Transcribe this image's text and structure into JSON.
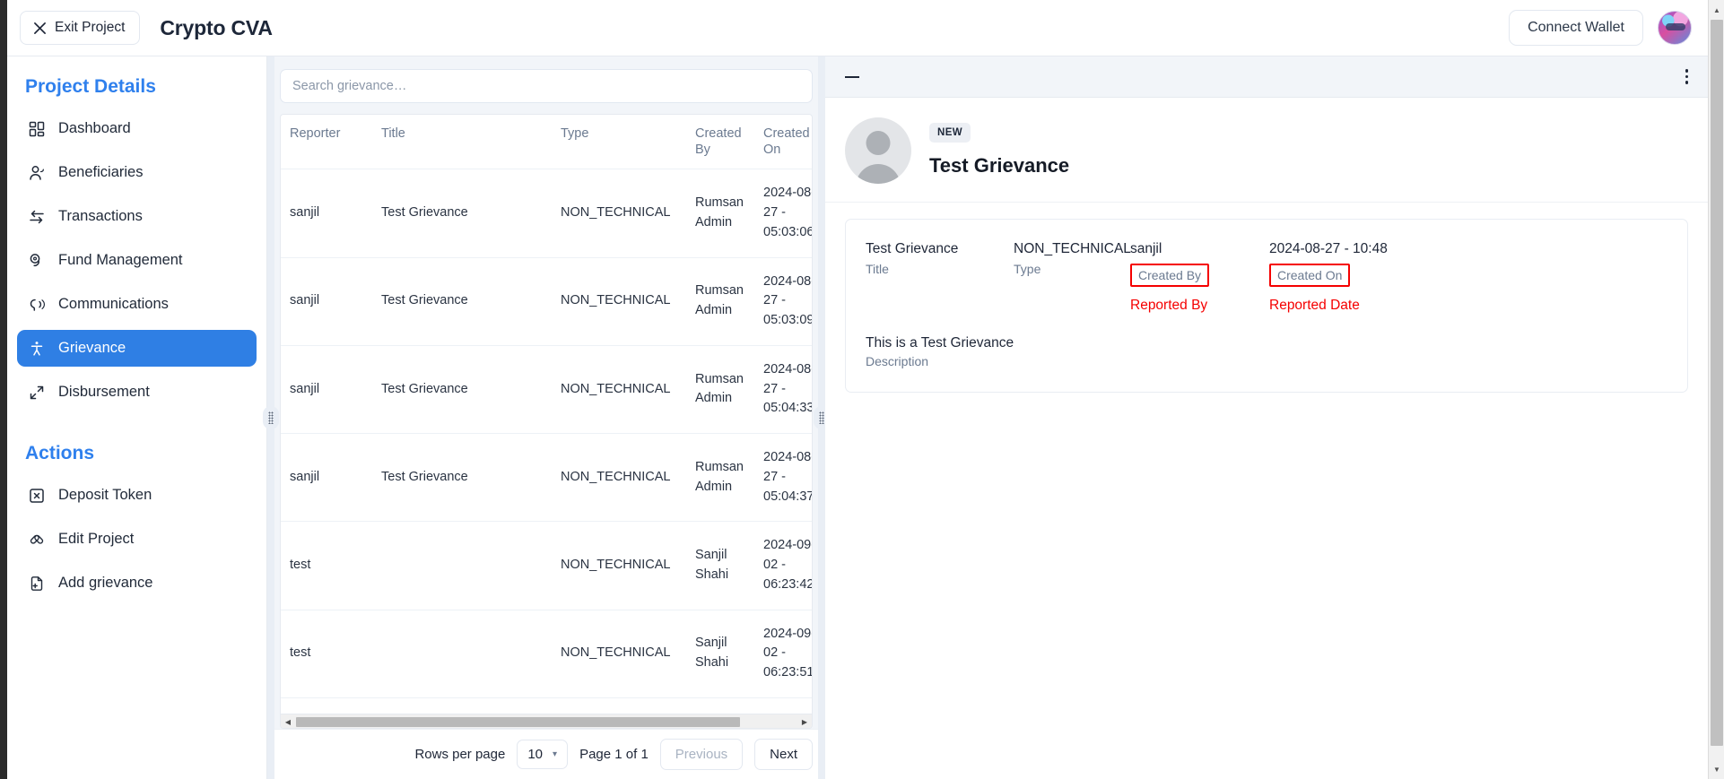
{
  "topbar": {
    "exit_label": "Exit Project",
    "app_title": "Crypto CVA",
    "connect_label": "Connect Wallet",
    "avatar_name": "user-avatar"
  },
  "sidebar": {
    "project_heading": "Project Details",
    "actions_heading": "Actions",
    "nav": [
      {
        "label": "Dashboard",
        "icon": "grid-icon",
        "active": false
      },
      {
        "label": "Beneficiaries",
        "icon": "users-icon",
        "active": false
      },
      {
        "label": "Transactions",
        "icon": "transfer-icon",
        "active": false
      },
      {
        "label": "Fund Management",
        "icon": "coins-icon",
        "active": false
      },
      {
        "label": "Communications",
        "icon": "megaphone-icon",
        "active": false
      },
      {
        "label": "Grievance",
        "icon": "accessibility-icon",
        "active": true
      },
      {
        "label": "Disbursement",
        "icon": "expand-icon",
        "active": false
      }
    ],
    "actions": [
      {
        "label": "Deposit Token",
        "icon": "token-box-icon"
      },
      {
        "label": "Edit Project",
        "icon": "edit-icon"
      },
      {
        "label": "Add grievance",
        "icon": "file-plus-icon"
      }
    ]
  },
  "list": {
    "search_placeholder": "Search grievance…",
    "search_value": "",
    "columns": [
      "Reporter",
      "Title",
      "Type",
      "Created By",
      "Created On"
    ],
    "rows": [
      {
        "reporter": "sanjil",
        "title": "Test Grievance",
        "type": "NON_TECHNICAL",
        "created_by": "Rumsan Admin",
        "created_on": "2024-08-27 - 05:03:06"
      },
      {
        "reporter": "sanjil",
        "title": "Test Grievance",
        "type": "NON_TECHNICAL",
        "created_by": "Rumsan Admin",
        "created_on": "2024-08-27 - 05:03:09"
      },
      {
        "reporter": "sanjil",
        "title": "Test Grievance",
        "type": "NON_TECHNICAL",
        "created_by": "Rumsan Admin",
        "created_on": "2024-08-27 - 05:04:33"
      },
      {
        "reporter": "sanjil",
        "title": "Test Grievance",
        "type": "NON_TECHNICAL",
        "created_by": "Rumsan Admin",
        "created_on": "2024-08-27 - 05:04:37"
      },
      {
        "reporter": "test",
        "title": "",
        "type": "NON_TECHNICAL",
        "created_by": "Sanjil Shahi",
        "created_on": "2024-09-02 - 06:23:42"
      },
      {
        "reporter": "test",
        "title": "",
        "type": "NON_TECHNICAL",
        "created_by": "Sanjil Shahi",
        "created_on": "2024-09-02 - 06:23:51"
      }
    ],
    "pagination": {
      "rows_per_page_label": "Rows per page",
      "rows_per_page_value": "10",
      "page_label": "Page 1 of 1",
      "previous_label": "Previous",
      "next_label": "Next"
    }
  },
  "detail": {
    "status": "NEW",
    "title": "Test Grievance",
    "fields": [
      {
        "value": "Test Grievance",
        "label": "Title",
        "boxed": false,
        "annotation": ""
      },
      {
        "value": "NON_TECHNICAL",
        "label": "Type",
        "boxed": false,
        "annotation": ""
      },
      {
        "value": "sanjil",
        "label": "Created By",
        "boxed": true,
        "annotation": "Reported By"
      },
      {
        "value": "2024-08-27 - 10:48",
        "label": "Created On",
        "boxed": true,
        "annotation": "Reported Date"
      }
    ],
    "description_value": "This is a Test Grievance",
    "description_label": "Description"
  },
  "colors": {
    "accent_blue": "#2f7fe4",
    "heading_blue": "#2f80ed",
    "annotation_red": "#f50000",
    "panel_bg": "#f2f5f9",
    "border": "#e6eaf0"
  }
}
